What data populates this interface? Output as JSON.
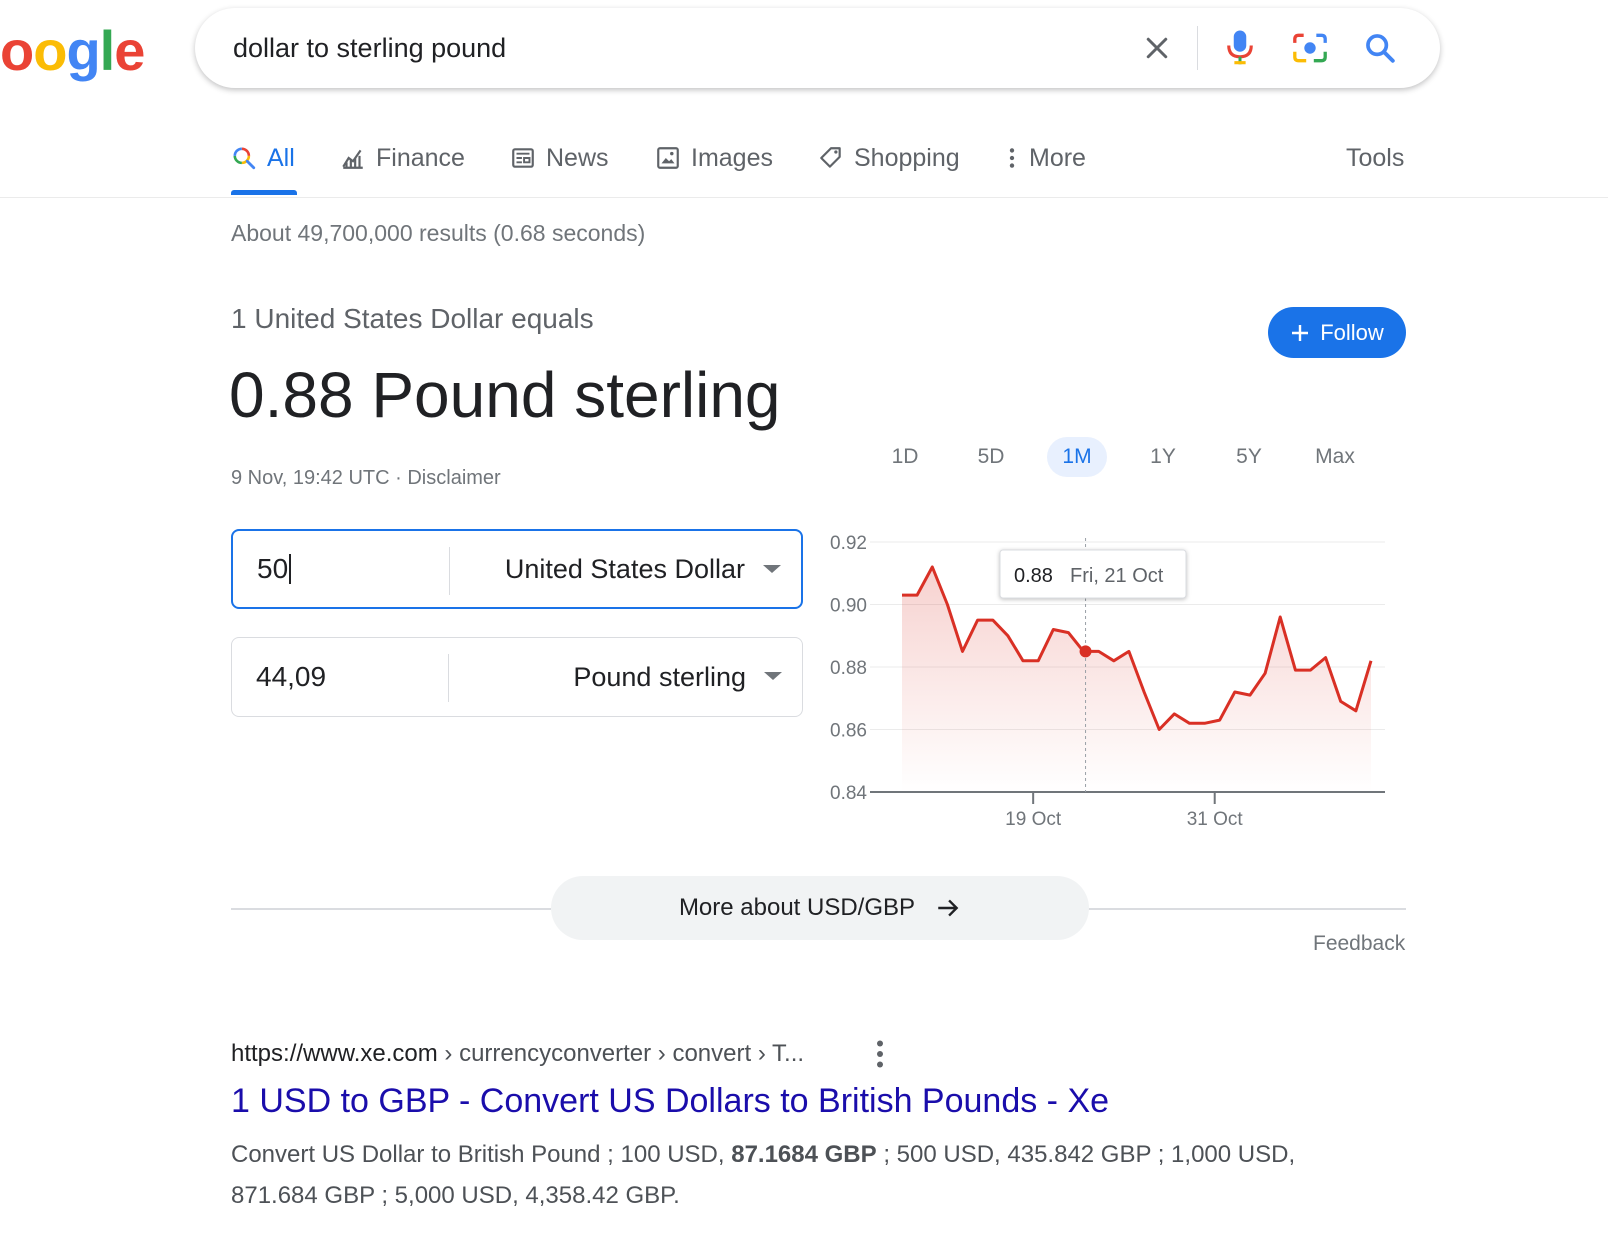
{
  "logo": {
    "letters": [
      "o",
      "o",
      "g",
      "l",
      "e"
    ],
    "colors": [
      "#ea4335",
      "#fbbc05",
      "#4285f4",
      "#34a853",
      "#ea4335"
    ]
  },
  "search": {
    "query": "dollar to sterling pound"
  },
  "tabs": [
    {
      "label": "All",
      "icon": "search-icon",
      "active": true
    },
    {
      "label": "Finance",
      "icon": "finance-icon"
    },
    {
      "label": "News",
      "icon": "news-icon"
    },
    {
      "label": "Images",
      "icon": "image-icon"
    },
    {
      "label": "Shopping",
      "icon": "tag-icon"
    },
    {
      "label": "More",
      "icon": "more-vert-icon"
    }
  ],
  "tools_label": "Tools",
  "results_stats": "About 49,700,000 results (0.68 seconds)",
  "finance": {
    "equals_label": "1 United States Dollar equals",
    "rate_value": "0.88 Pound sterling",
    "follow_label": "Follow",
    "timestamp": "9 Nov, 19:42 UTC · ",
    "disclaimer": "Disclaimer",
    "from_amount": "50",
    "from_currency": "United States Dollar",
    "to_amount": "44,09",
    "to_currency": "Pound sterling",
    "ranges": [
      "1D",
      "5D",
      "1M",
      "1Y",
      "5Y",
      "Max"
    ],
    "active_range": "1M",
    "more_label": "More about USD/GBP",
    "feedback_label": "Feedback",
    "accent_color": "#1a73e8",
    "line_color": "#d93025"
  },
  "chart_data": {
    "type": "area",
    "ylim": [
      0.84,
      0.92
    ],
    "yticks": [
      "0.92",
      "0.90",
      "0.88",
      "0.86",
      "0.84"
    ],
    "xticks": [
      "19 Oct",
      "31 Oct"
    ],
    "tooltip": {
      "value": "0.88",
      "date": "Fri, 21 Oct"
    },
    "values": [
      0.903,
      0.903,
      0.912,
      0.9,
      0.885,
      0.895,
      0.895,
      0.89,
      0.882,
      0.882,
      0.892,
      0.891,
      0.885,
      0.885,
      0.882,
      0.885,
      0.872,
      0.86,
      0.865,
      0.862,
      0.862,
      0.863,
      0.872,
      0.871,
      0.878,
      0.896,
      0.879,
      0.879,
      0.883,
      0.869,
      0.866,
      0.882
    ]
  },
  "result": {
    "url_host": "https://www.xe.com",
    "url_path": " › currencyconverter › convert › T...",
    "title": "1 USD to GBP - Convert US Dollars to British Pounds - Xe",
    "snippet_a": "Convert US Dollar to British Pound ; 100 USD, ",
    "snippet_bold": "87.1684 GBP",
    "snippet_b": " ; 500 USD, 435.842 GBP ; 1,000 USD, 871.684 GBP ; 5,000 USD, 4,358.42 GBP."
  }
}
